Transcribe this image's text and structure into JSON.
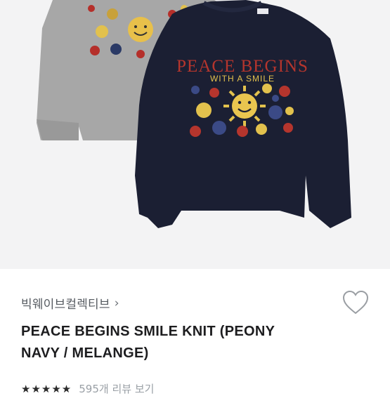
{
  "product": {
    "brand": "빅웨이브컬렉티브",
    "brand_chevron": "›",
    "title": "PEACE BEGINS SMILE KNIT (PEONY NAVY / MELANGE)",
    "knit_text_line1": "PEACE BEGINS",
    "knit_text_line2": "WITH A SMILE"
  },
  "rating": {
    "stars": "★★★★★",
    "reviews_label": "595개 리뷰 보기"
  },
  "colors": {
    "photo_bg": "#f3f3f4",
    "navy": "#1b1f33",
    "melange": "#a8a8a8",
    "heart": "#9a9ea3"
  },
  "icons": {
    "heart": "heart-outline-icon",
    "chevron": "chevron-right-icon"
  }
}
